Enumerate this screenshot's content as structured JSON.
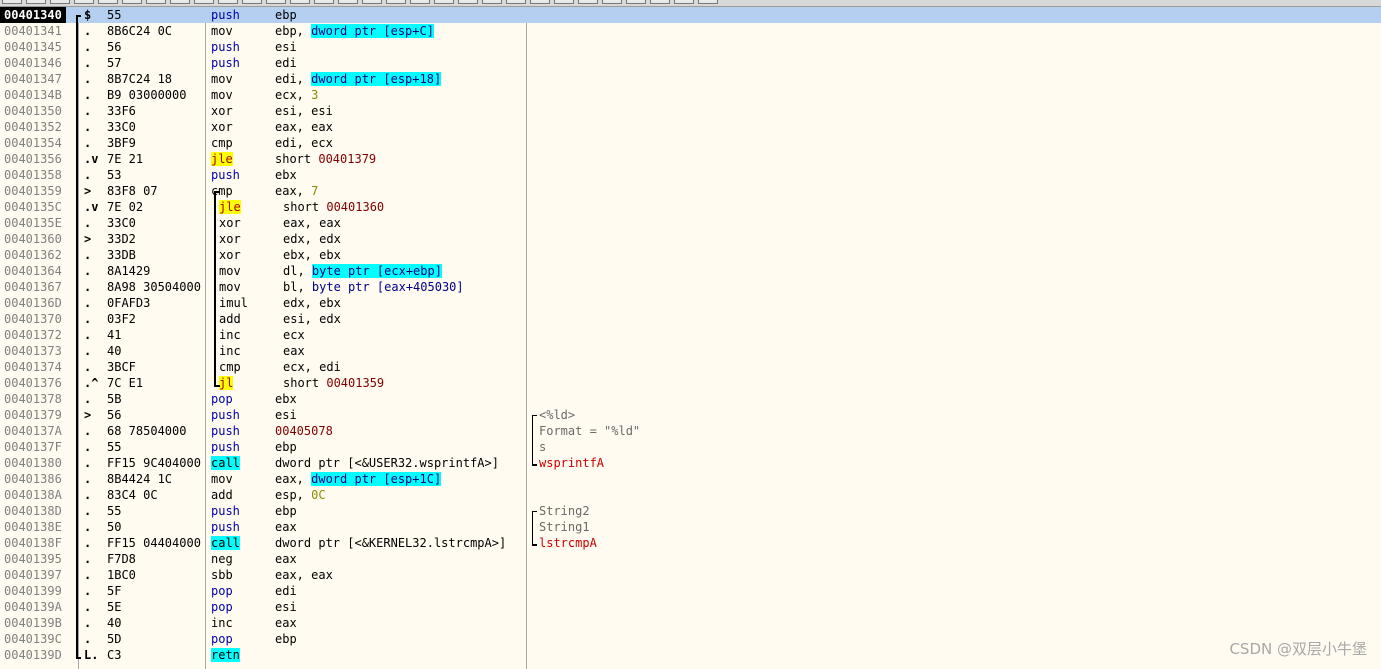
{
  "selected_index": 0,
  "rows": [
    {
      "addr": "00401340",
      "mk": "$",
      "hex": "55",
      "mn": "push",
      "op": "ebp",
      "cmt": ""
    },
    {
      "addr": "00401341",
      "mk": ".",
      "hex": "8B6C24 0C",
      "mn": "mov",
      "op": "ebp, ",
      "op_mem": "dword ptr [esp+C]",
      "cmt": ""
    },
    {
      "addr": "00401345",
      "mk": ".",
      "hex": "56",
      "mn": "push",
      "op": "esi",
      "cmt": ""
    },
    {
      "addr": "00401346",
      "mk": ".",
      "hex": "57",
      "mn": "push",
      "op": "edi",
      "cmt": ""
    },
    {
      "addr": "00401347",
      "mk": ".",
      "hex": "8B7C24 18",
      "mn": "mov",
      "op": "edi, ",
      "op_mem": "dword ptr [esp+18]",
      "cmt": ""
    },
    {
      "addr": "0040134B",
      "mk": ".",
      "hex": "B9 03000000",
      "mn": "mov",
      "op": "ecx, ",
      "op_imm": "3",
      "cmt": ""
    },
    {
      "addr": "00401350",
      "mk": ".",
      "hex": "33F6",
      "mn": "xor",
      "op": "esi, esi",
      "cmt": ""
    },
    {
      "addr": "00401352",
      "mk": ".",
      "hex": "33C0",
      "mn": "xor",
      "op": "eax, eax",
      "cmt": ""
    },
    {
      "addr": "00401354",
      "mk": ".",
      "hex": "3BF9",
      "mn": "cmp",
      "op": "edi, ecx",
      "cmt": ""
    },
    {
      "addr": "00401356",
      "mk": ".v",
      "hex": "7E 21",
      "mn": "jle",
      "op": "short ",
      "op_tgt": "00401379",
      "cmt": ""
    },
    {
      "addr": "00401358",
      "mk": ".",
      "hex": "53",
      "mn": "push",
      "op": "ebx",
      "cmt": ""
    },
    {
      "addr": "00401359",
      "mk": ">",
      "hex": "83F8 07",
      "mn": "cmp",
      "op": "eax, ",
      "op_imm": "7",
      "cmt": ""
    },
    {
      "addr": "0040135C",
      "mk": ".v",
      "hex": "7E 02",
      "mn": "jle",
      "op": "short ",
      "op_tgt": "00401360",
      "cmt": ""
    },
    {
      "addr": "0040135E",
      "mk": ".",
      "hex": "33C0",
      "mn": "xor",
      "op": "eax, eax",
      "cmt": ""
    },
    {
      "addr": "00401360",
      "mk": ">",
      "hex": "33D2",
      "mn": "xor",
      "op": "edx, edx",
      "cmt": ""
    },
    {
      "addr": "00401362",
      "mk": ".",
      "hex": "33DB",
      "mn": "xor",
      "op": "ebx, ebx",
      "cmt": ""
    },
    {
      "addr": "00401364",
      "mk": ".",
      "hex": "8A1429",
      "mn": "mov",
      "op": "dl, ",
      "op_mem": "byte ptr [ecx+ebp]",
      "cmt": ""
    },
    {
      "addr": "00401367",
      "mk": ".",
      "hex": "8A98 30504000",
      "mn": "mov",
      "op": "bl, ",
      "op_mem_plain": "byte ptr [eax+405030]",
      "cmt": ""
    },
    {
      "addr": "0040136D",
      "mk": ".",
      "hex": "0FAFD3",
      "mn": "imul",
      "op": "edx, ebx",
      "cmt": ""
    },
    {
      "addr": "00401370",
      "mk": ".",
      "hex": "03F2",
      "mn": "add",
      "op": "esi, edx",
      "cmt": ""
    },
    {
      "addr": "00401372",
      "mk": ".",
      "hex": "41",
      "mn": "inc",
      "op": "ecx",
      "cmt": ""
    },
    {
      "addr": "00401373",
      "mk": ".",
      "hex": "40",
      "mn": "inc",
      "op": "eax",
      "cmt": ""
    },
    {
      "addr": "00401374",
      "mk": ".",
      "hex": "3BCF",
      "mn": "cmp",
      "op": "ecx, edi",
      "cmt": ""
    },
    {
      "addr": "00401376",
      "mk": ".^",
      "hex": "7C E1",
      "mn": "jl",
      "op": "short ",
      "op_tgt": "00401359",
      "cmt": ""
    },
    {
      "addr": "00401378",
      "mk": ".",
      "hex": "5B",
      "mn": "pop",
      "op": "ebx",
      "cmt": ""
    },
    {
      "addr": "00401379",
      "mk": ">",
      "hex": "56",
      "mn": "push",
      "op": "esi",
      "cmt": "<%ld>"
    },
    {
      "addr": "0040137A",
      "mk": ".",
      "hex": "68 78504000",
      "mn": "push",
      "op": "",
      "op_tgt": "00405078",
      "cmt": "Format = \"%ld\""
    },
    {
      "addr": "0040137F",
      "mk": ".",
      "hex": "55",
      "mn": "push",
      "op": "ebp",
      "cmt": "s"
    },
    {
      "addr": "00401380",
      "mk": ".",
      "hex": "FF15 9C404000",
      "mn": "call",
      "op": "dword ptr [<&USER32.wsprintfA>]",
      "cmt": "wsprintfA"
    },
    {
      "addr": "00401386",
      "mk": ".",
      "hex": "8B4424 1C",
      "mn": "mov",
      "op": "eax, ",
      "op_mem": "dword ptr [esp+1C]",
      "cmt": ""
    },
    {
      "addr": "0040138A",
      "mk": ".",
      "hex": "83C4 0C",
      "mn": "add",
      "op": "esp, ",
      "op_imm": "0C",
      "cmt": ""
    },
    {
      "addr": "0040138D",
      "mk": ".",
      "hex": "55",
      "mn": "push",
      "op": "ebp",
      "cmt": "String2"
    },
    {
      "addr": "0040138E",
      "mk": ".",
      "hex": "50",
      "mn": "push",
      "op": "eax",
      "cmt": "String1"
    },
    {
      "addr": "0040138F",
      "mk": ".",
      "hex": "FF15 04404000",
      "mn": "call",
      "op": "dword ptr [<&KERNEL32.lstrcmpA>]",
      "cmt": "lstrcmpA"
    },
    {
      "addr": "00401395",
      "mk": ".",
      "hex": "F7D8",
      "mn": "neg",
      "op": "eax",
      "cmt": ""
    },
    {
      "addr": "00401397",
      "mk": ".",
      "hex": "1BC0",
      "mn": "sbb",
      "op": "eax, eax",
      "cmt": ""
    },
    {
      "addr": "00401399",
      "mk": ".",
      "hex": "5F",
      "mn": "pop",
      "op": "edi",
      "cmt": ""
    },
    {
      "addr": "0040139A",
      "mk": ".",
      "hex": "5E",
      "mn": "pop",
      "op": "esi",
      "cmt": ""
    },
    {
      "addr": "0040139B",
      "mk": ".",
      "hex": "40",
      "mn": "inc",
      "op": "eax",
      "cmt": ""
    },
    {
      "addr": "0040139C",
      "mk": ".",
      "hex": "5D",
      "mn": "pop",
      "op": "ebp",
      "cmt": ""
    },
    {
      "addr": "0040139D",
      "mk": "L.",
      "hex": "C3",
      "mn": "retn",
      "op": "",
      "cmt": ""
    }
  ],
  "watermark": "CSDN @双层小牛堡"
}
